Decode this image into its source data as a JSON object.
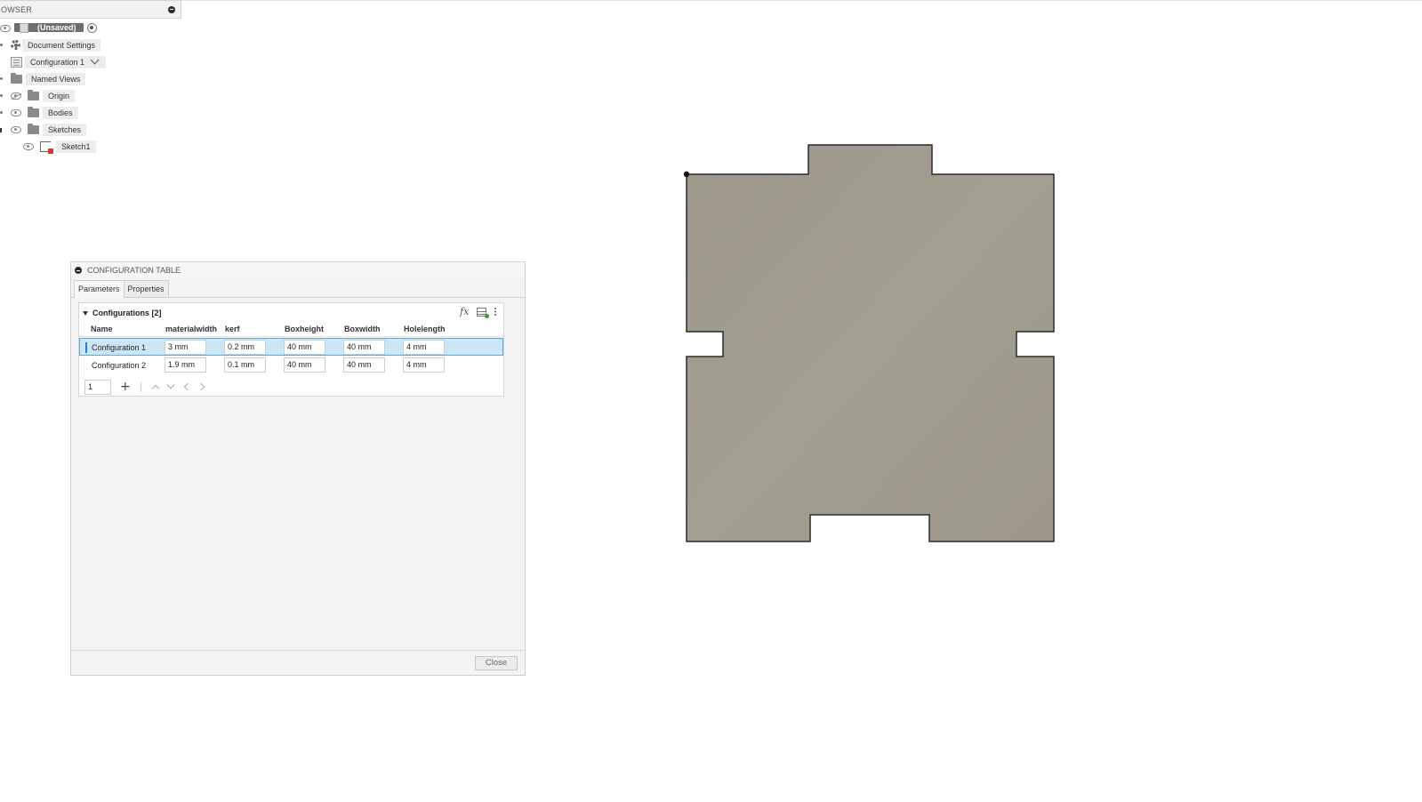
{
  "browser": {
    "title": "OWSER",
    "root": {
      "label": "(Unsaved)"
    },
    "items": [
      {
        "label": "Document Settings"
      },
      {
        "label": "Configuration 1"
      },
      {
        "label": "Named Views"
      },
      {
        "label": "Origin"
      },
      {
        "label": "Bodies"
      },
      {
        "label": "Sketches"
      },
      {
        "label": "Sketch1"
      }
    ]
  },
  "config_table": {
    "title": "CONFIGURATION TABLE",
    "tabs": [
      {
        "label": "Parameters"
      },
      {
        "label": "Properties"
      }
    ],
    "section_title": "Configurations [2]",
    "fx_label": "fx",
    "columns": [
      "Name",
      "materialwidth",
      "kerf",
      "Boxheight",
      "Boxwidth",
      "Holelength"
    ],
    "rows": [
      {
        "name": "Configuration 1",
        "values": [
          "3 mm",
          "0.2 mm",
          "40 mm",
          "40 mm",
          "4 mm"
        ],
        "selected": true
      },
      {
        "name": "Configuration 2",
        "values": [
          "1.9 mm",
          "0.1 mm",
          "40 mm",
          "40 mm",
          "4 mm"
        ],
        "selected": false
      }
    ],
    "page_value": "1",
    "add_label": "+",
    "close_label": "Close"
  },
  "colors": {
    "sketch_fill": "#a09b8c",
    "sketch_stroke": "#2a2a2a",
    "selection_bg": "#cce6f7",
    "selection_accent": "#2e7fc4"
  }
}
